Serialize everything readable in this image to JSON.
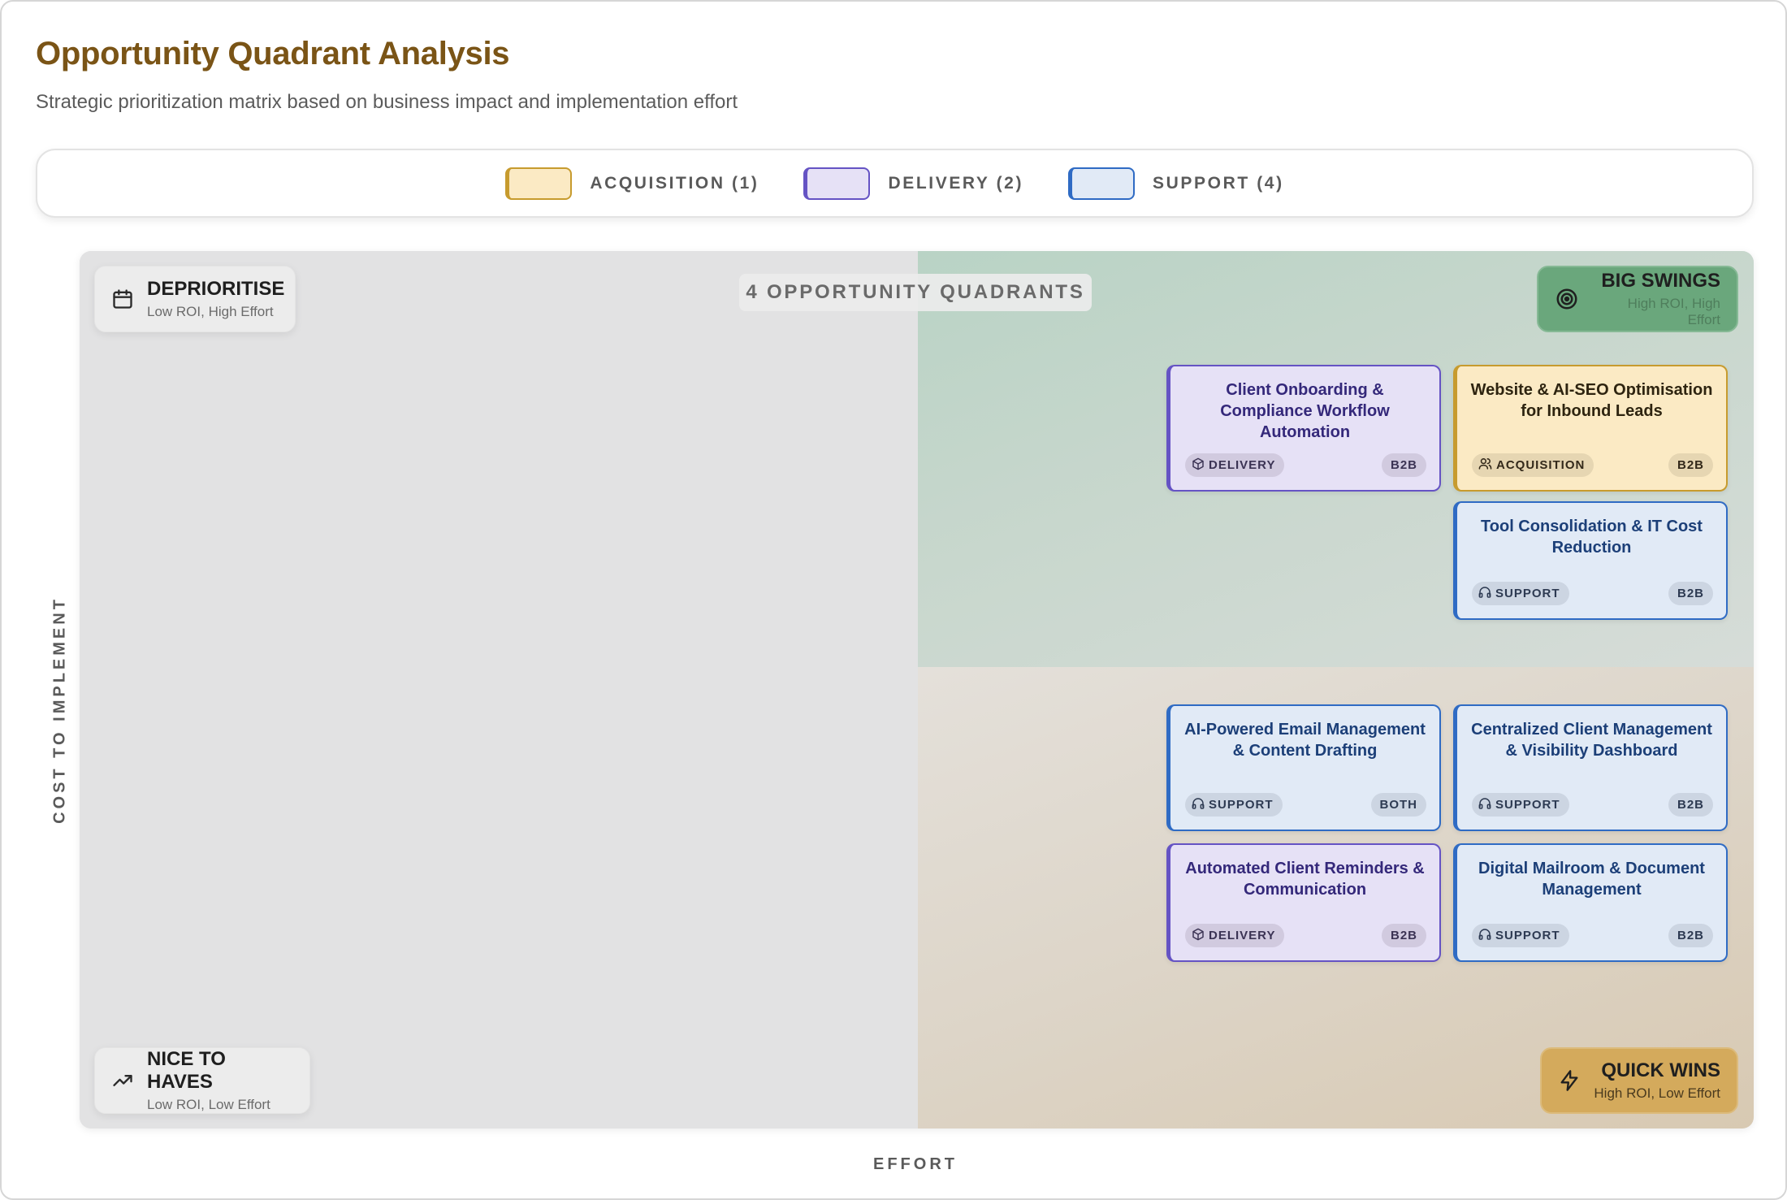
{
  "header": {
    "title": "Opportunity Quadrant Analysis",
    "subtitle": "Strategic prioritization matrix based on business impact and implementation effort"
  },
  "legend": {
    "items": [
      {
        "label": "ACQUISITION (1)",
        "fill": "#fbeac4",
        "border": "#c79b2e"
      },
      {
        "label": "DELIVERY (2)",
        "fill": "#e6e1f6",
        "border": "#6553c4"
      },
      {
        "label": "SUPPORT (4)",
        "fill": "#e1eaf6",
        "border": "#2f6bc4"
      }
    ]
  },
  "matrix": {
    "center_label": "4 OPPORTUNITY QUADRANTS",
    "quadrants": {
      "deprioritise": {
        "title": "DEPRIORITISE",
        "subtitle": "Low ROI, High Effort"
      },
      "nice_to_haves": {
        "title": "NICE TO HAVES",
        "subtitle": "Low ROI, Low Effort"
      },
      "big_swings": {
        "title": "BIG SWINGS",
        "subtitle": "High ROI, High Effort"
      },
      "quick_wins": {
        "title": "QUICK WINS",
        "subtitle": "High ROI, Low Effort"
      }
    },
    "cards": [
      {
        "title": "Client Onboarding & Compliance Workflow Automation",
        "category": "DELIVERY",
        "market": "B2B",
        "quadrant": "big_swings"
      },
      {
        "title": "Website & AI-SEO Optimisation for Inbound Leads",
        "category": "ACQUISITION",
        "market": "B2B",
        "quadrant": "big_swings"
      },
      {
        "title": "Tool Consolidation & IT Cost Reduction",
        "category": "SUPPORT",
        "market": "B2B",
        "quadrant": "big_swings"
      },
      {
        "title": "AI-Powered Email Management & Content Drafting",
        "category": "SUPPORT",
        "market": "BOTH",
        "quadrant": "quick_wins"
      },
      {
        "title": "Centralized Client Management & Visibility Dashboard",
        "category": "SUPPORT",
        "market": "B2B",
        "quadrant": "quick_wins"
      },
      {
        "title": "Automated Client Reminders & Communication",
        "category": "DELIVERY",
        "market": "B2B",
        "quadrant": "quick_wins"
      },
      {
        "title": "Digital Mailroom & Document Management",
        "category": "SUPPORT",
        "market": "B2B",
        "quadrant": "quick_wins"
      }
    ],
    "y_axis_label": "COST TO IMPLEMENT",
    "x_axis_label": "EFFORT"
  }
}
